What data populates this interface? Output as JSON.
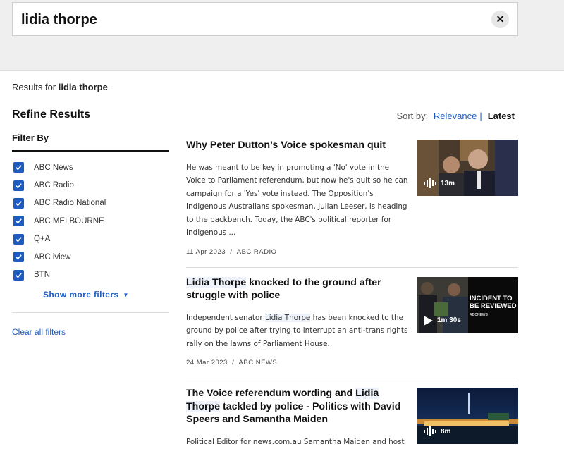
{
  "search": {
    "query": "lidia thorpe",
    "clear_icon": "close-icon"
  },
  "results_header": {
    "prefix": "Results for",
    "query": "lidia thorpe"
  },
  "sidebar": {
    "title": "Refine Results",
    "filter_by": "Filter By",
    "filters": [
      {
        "label": "ABC News",
        "checked": true
      },
      {
        "label": "ABC Radio",
        "checked": true
      },
      {
        "label": "ABC Radio National",
        "checked": true
      },
      {
        "label": "ABC MELBOURNE",
        "checked": true
      },
      {
        "label": "Q+A",
        "checked": true
      },
      {
        "label": "ABC iview",
        "checked": true
      },
      {
        "label": "BTN",
        "checked": true
      }
    ],
    "show_more": "Show more filters",
    "clear_all": "Clear all filters"
  },
  "sort": {
    "label": "Sort by:",
    "options": [
      "Relevance",
      "Latest"
    ],
    "selected": "Latest"
  },
  "colors": {
    "accent": "#1d5bbf",
    "highlight": "#eef3fb"
  },
  "results": [
    {
      "title": "Why Peter Dutton’s Voice spokesman quit",
      "description": "He was meant to be key in promoting a 'No' vote in the Voice to Parliament referendum, but now he's quit so he can campaign for a 'Yes' vote instead. The Opposition's Indigenous Australians spokesman, Julian Leeser, is heading to the backbench. Today, the ABC's political reporter for Indigenous ...",
      "date": "11 Apr 2023",
      "source": "ABC RADIO",
      "media": {
        "type": "audio",
        "icon": "audio-waveform-icon",
        "duration": "13m"
      }
    },
    {
      "title_parts": [
        "Lidia Thorpe",
        " knocked to the ground after struggle with police"
      ],
      "description_parts": [
        "Independent senator ",
        "Lidia Thorpe",
        " has been knocked to the ground by police after trying to interrupt an anti-trans rights rally on the lawns of Parliament House."
      ],
      "date": "24 Mar 2023",
      "source": "ABC NEWS",
      "media": {
        "type": "video",
        "icon": "play-icon",
        "duration": "1m 30s",
        "overlay_text": [
          "INCIDENT TO",
          "BE REVIEWED"
        ],
        "overlay_brand": "ABCNEWS"
      }
    },
    {
      "title_parts": [
        "The Voice referendum wording and ",
        "Lidia Thorpe",
        " tackled by police - Politics with David Speers and Samantha Maiden"
      ],
      "description": "Political Editor for news.com.au Samantha Maiden and host",
      "media": {
        "type": "audio",
        "icon": "audio-waveform-icon",
        "duration": "8m"
      }
    }
  ]
}
